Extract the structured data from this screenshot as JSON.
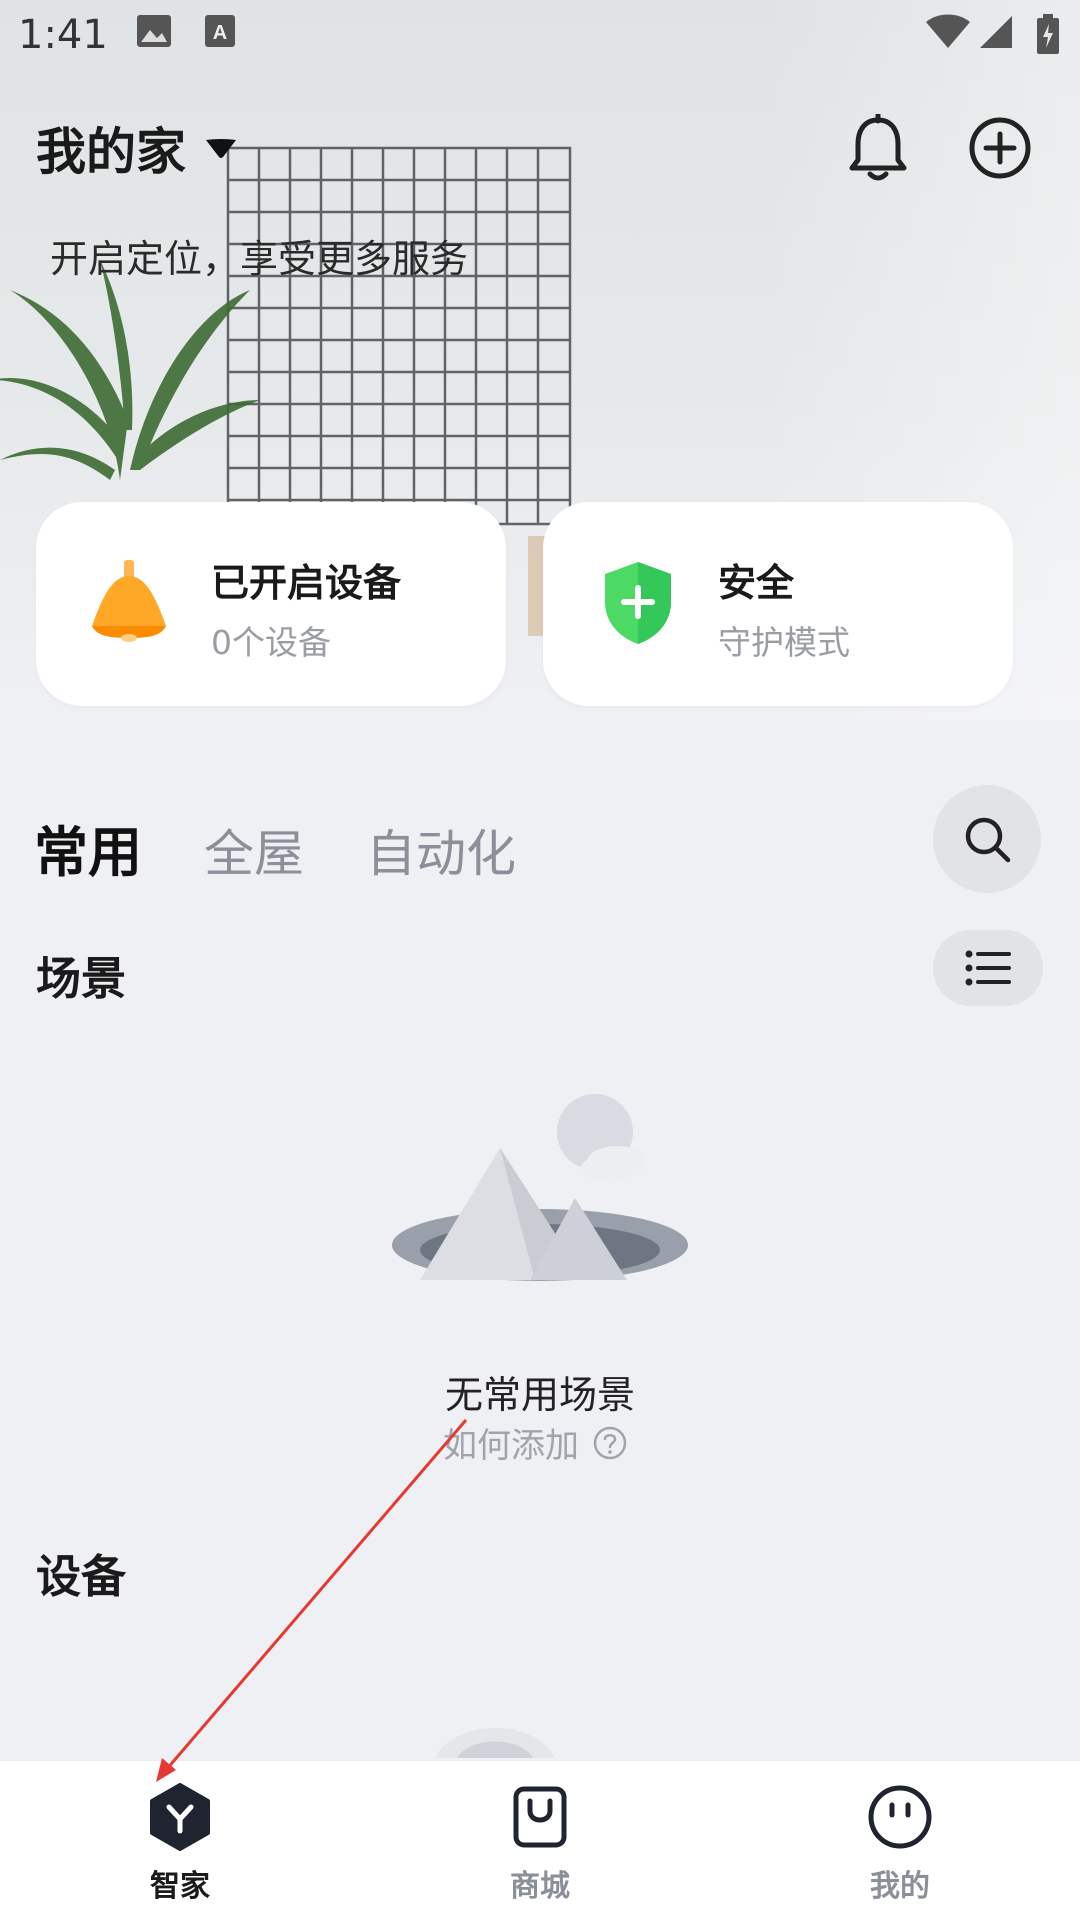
{
  "status_bar": {
    "time": "1:41"
  },
  "header": {
    "title": "我的家",
    "location_hint": "开启定位，享受更多服务"
  },
  "cards": [
    {
      "title": "已开启设备",
      "subtitle": "0个设备",
      "icon": "lamp-icon",
      "accent": "#ffa726"
    },
    {
      "title": "安全",
      "subtitle": "守护模式",
      "icon": "shield-plus-icon",
      "accent": "#4cd964"
    }
  ],
  "tabs": [
    {
      "label": "常用",
      "active": true
    },
    {
      "label": "全屋",
      "active": false
    },
    {
      "label": "自动化",
      "active": false
    }
  ],
  "scenes": {
    "title": "场景",
    "empty_title": "无常用场景",
    "empty_help": "如何添加"
  },
  "devices": {
    "title": "设备"
  },
  "tabbar": [
    {
      "label": "智家",
      "icon": "home-hex-icon",
      "active": true
    },
    {
      "label": "商城",
      "icon": "shopping-bag-icon",
      "active": false
    },
    {
      "label": "我的",
      "icon": "face-icon",
      "active": false
    }
  ],
  "colors": {
    "background": "#eff0f3",
    "annotation_arrow": "#e53935"
  }
}
